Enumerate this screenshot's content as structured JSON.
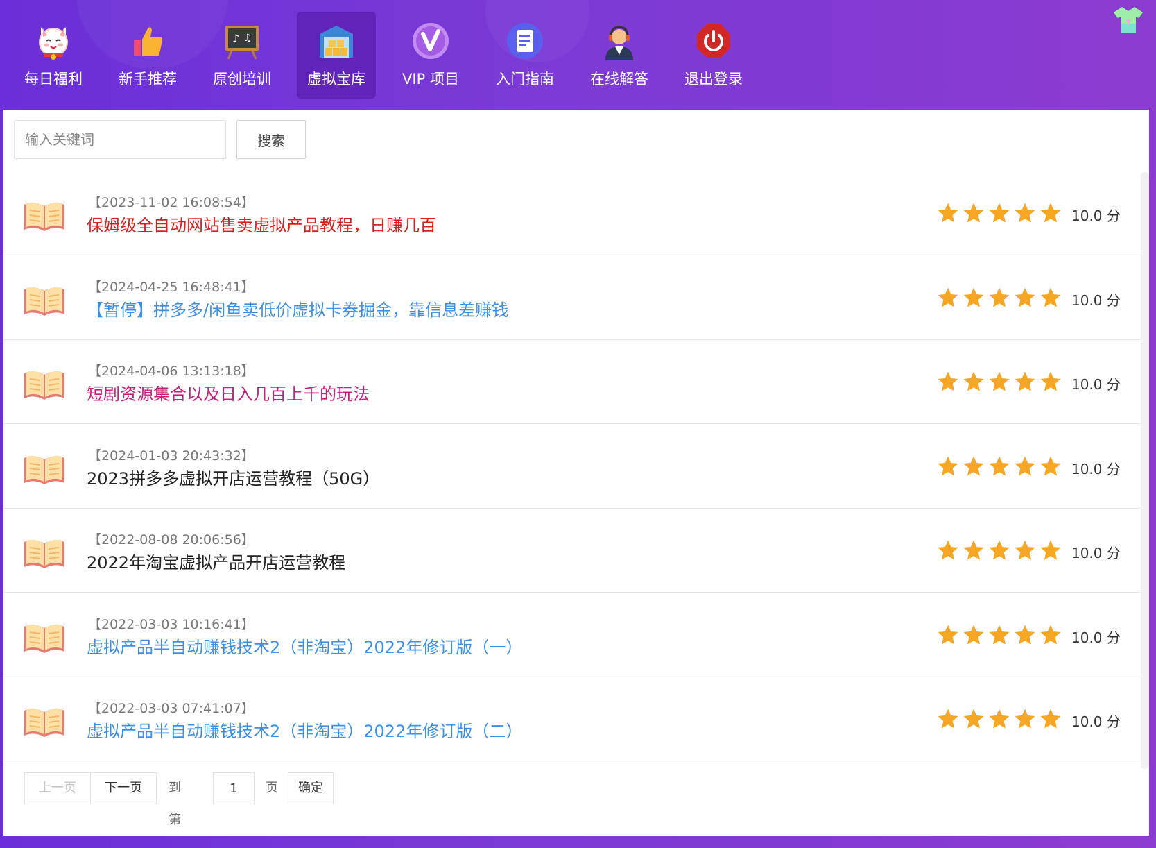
{
  "nav": {
    "items": [
      {
        "label": "每日福利",
        "icon": "lucky-cat-icon"
      },
      {
        "label": "新手推荐",
        "icon": "thumbs-up-icon"
      },
      {
        "label": "原创培训",
        "icon": "chalkboard-icon"
      },
      {
        "label": "虚拟宝库",
        "icon": "warehouse-icon",
        "active": true
      },
      {
        "label": "VIP 项目",
        "icon": "vip-icon"
      },
      {
        "label": "入门指南",
        "icon": "document-icon"
      },
      {
        "label": "在线解答",
        "icon": "support-agent-icon"
      },
      {
        "label": "退出登录",
        "icon": "power-icon"
      }
    ]
  },
  "search": {
    "placeholder": "输入关键词",
    "button_label": "搜索"
  },
  "articles": [
    {
      "date": "【2023-11-02 16:08:54】",
      "title": "保姆级全自动网站售卖虚拟产品教程，日赚几百",
      "color": "#d71f1f",
      "stars": 5,
      "score": "10.0 分"
    },
    {
      "date": "【2024-04-25 16:48:41】",
      "title": "【暂停】拼多多/闲鱼卖低价虚拟卡券掘金，靠信息差赚钱",
      "color": "#3d8fe6",
      "stars": 5,
      "score": "10.0 分"
    },
    {
      "date": "【2024-04-06 13:13:18】",
      "title": "短剧资源集合以及日入几百上千的玩法",
      "color": "#c71e7a",
      "stars": 5,
      "score": "10.0 分"
    },
    {
      "date": "【2024-01-03 20:43:32】",
      "title": "2023拼多多虚拟开店运营教程（50G）",
      "color": "#222222",
      "stars": 5,
      "score": "10.0 分"
    },
    {
      "date": "【2022-08-08 20:06:56】",
      "title": "2022年淘宝虚拟产品开店运营教程",
      "color": "#222222",
      "stars": 5,
      "score": "10.0 分"
    },
    {
      "date": "【2022-03-03 10:16:41】",
      "title": "虚拟产品半自动赚钱技术2（非淘宝）2022年修订版（一）",
      "color": "#3d8fe6",
      "stars": 5,
      "score": "10.0 分"
    },
    {
      "date": "【2022-03-03 07:41:07】",
      "title": "虚拟产品半自动赚钱技术2（非淘宝）2022年修订版（二）",
      "color": "#3d8fe6",
      "stars": 5,
      "score": "10.0 分"
    }
  ],
  "pager": {
    "prev_label": "上一页",
    "next_label": "下一页",
    "goto_label": "到第",
    "page_value": "1",
    "page_unit": "页",
    "confirm_label": "确定"
  },
  "colors": {
    "star": "#f5a623",
    "accent": "#7b3ad6"
  }
}
